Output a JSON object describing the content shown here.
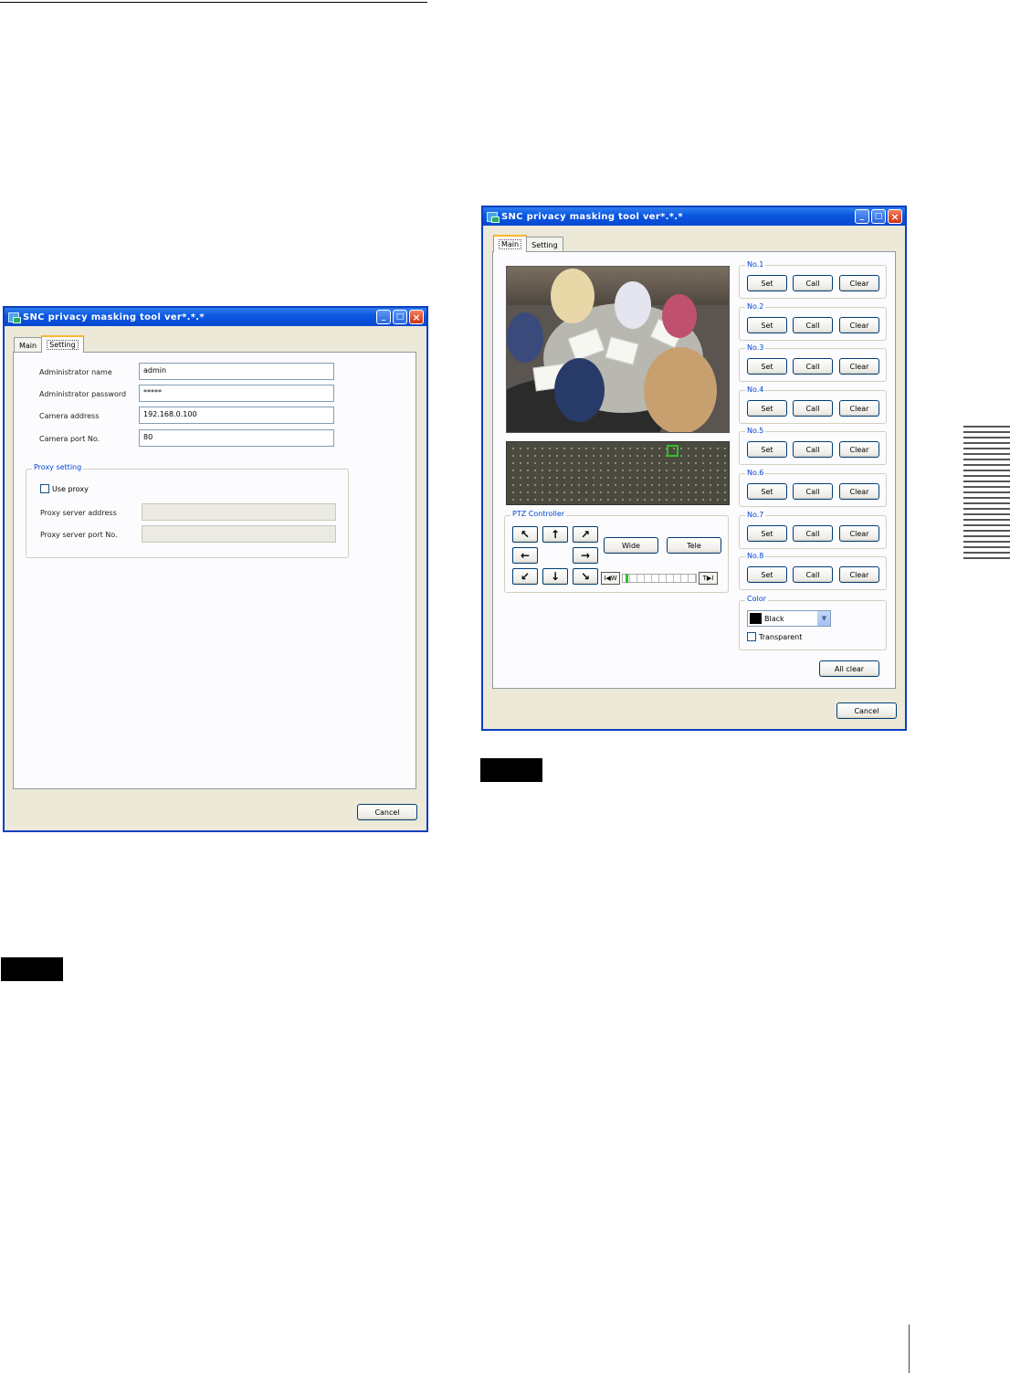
{
  "setting_window": {
    "title": "SNC privacy masking tool  ver*.*.*",
    "tabs": [
      {
        "label": "Main"
      },
      {
        "label": "Setting"
      }
    ],
    "fields": [
      {
        "label": "Administrator name",
        "value": "admin"
      },
      {
        "label": "Administrator password",
        "value": "*****"
      },
      {
        "label": "Camera address",
        "value": "192.168.0.100"
      },
      {
        "label": "Camera port No.",
        "value": "80"
      }
    ],
    "proxy": {
      "group_title": "Proxy setting",
      "use_proxy_label": "Use proxy",
      "use_proxy_checked": false,
      "server_address_label": "Proxy server address",
      "server_address_value": "",
      "server_port_label": "Proxy server port No.",
      "server_port_value": ""
    },
    "cancel_label": "Cancel"
  },
  "main_window": {
    "title": "SNC privacy masking tool  ver*.*.*",
    "tabs": [
      {
        "label": "Main"
      },
      {
        "label": "Setting"
      }
    ],
    "presets": [
      {
        "label": "No.1"
      },
      {
        "label": "No.2"
      },
      {
        "label": "No.3"
      },
      {
        "label": "No.4"
      },
      {
        "label": "No.5"
      },
      {
        "label": "No.6"
      },
      {
        "label": "No.7"
      },
      {
        "label": "No.8"
      }
    ],
    "set_label": "Set",
    "call_label": "Call",
    "clear_label": "Clear",
    "ptz": {
      "title": "PTZ Controller",
      "wide_label": "Wide",
      "tele_label": "Tele",
      "zoom_wide_end": "W",
      "zoom_tele_end": "T",
      "zoom_level": 0.02
    },
    "color": {
      "title": "Color",
      "selected": "Black",
      "selected_hex": "#000000",
      "transparent_label": "Transparent",
      "transparent_checked": false
    },
    "all_clear_label": "All clear",
    "cancel_label": "Cancel"
  },
  "colors": {
    "titlebar": "#0a56e0",
    "window_bg": "#ece9d8",
    "group_title": "#0046d5",
    "map_marker": "#2fbf2f"
  },
  "icons": {
    "direction_up_left": "↖",
    "direction_up": "↑",
    "direction_up_right": "↗",
    "direction_left": "←",
    "direction_right": "→",
    "direction_down_left": "↙",
    "direction_down": "↓",
    "direction_down_right": "↘"
  }
}
